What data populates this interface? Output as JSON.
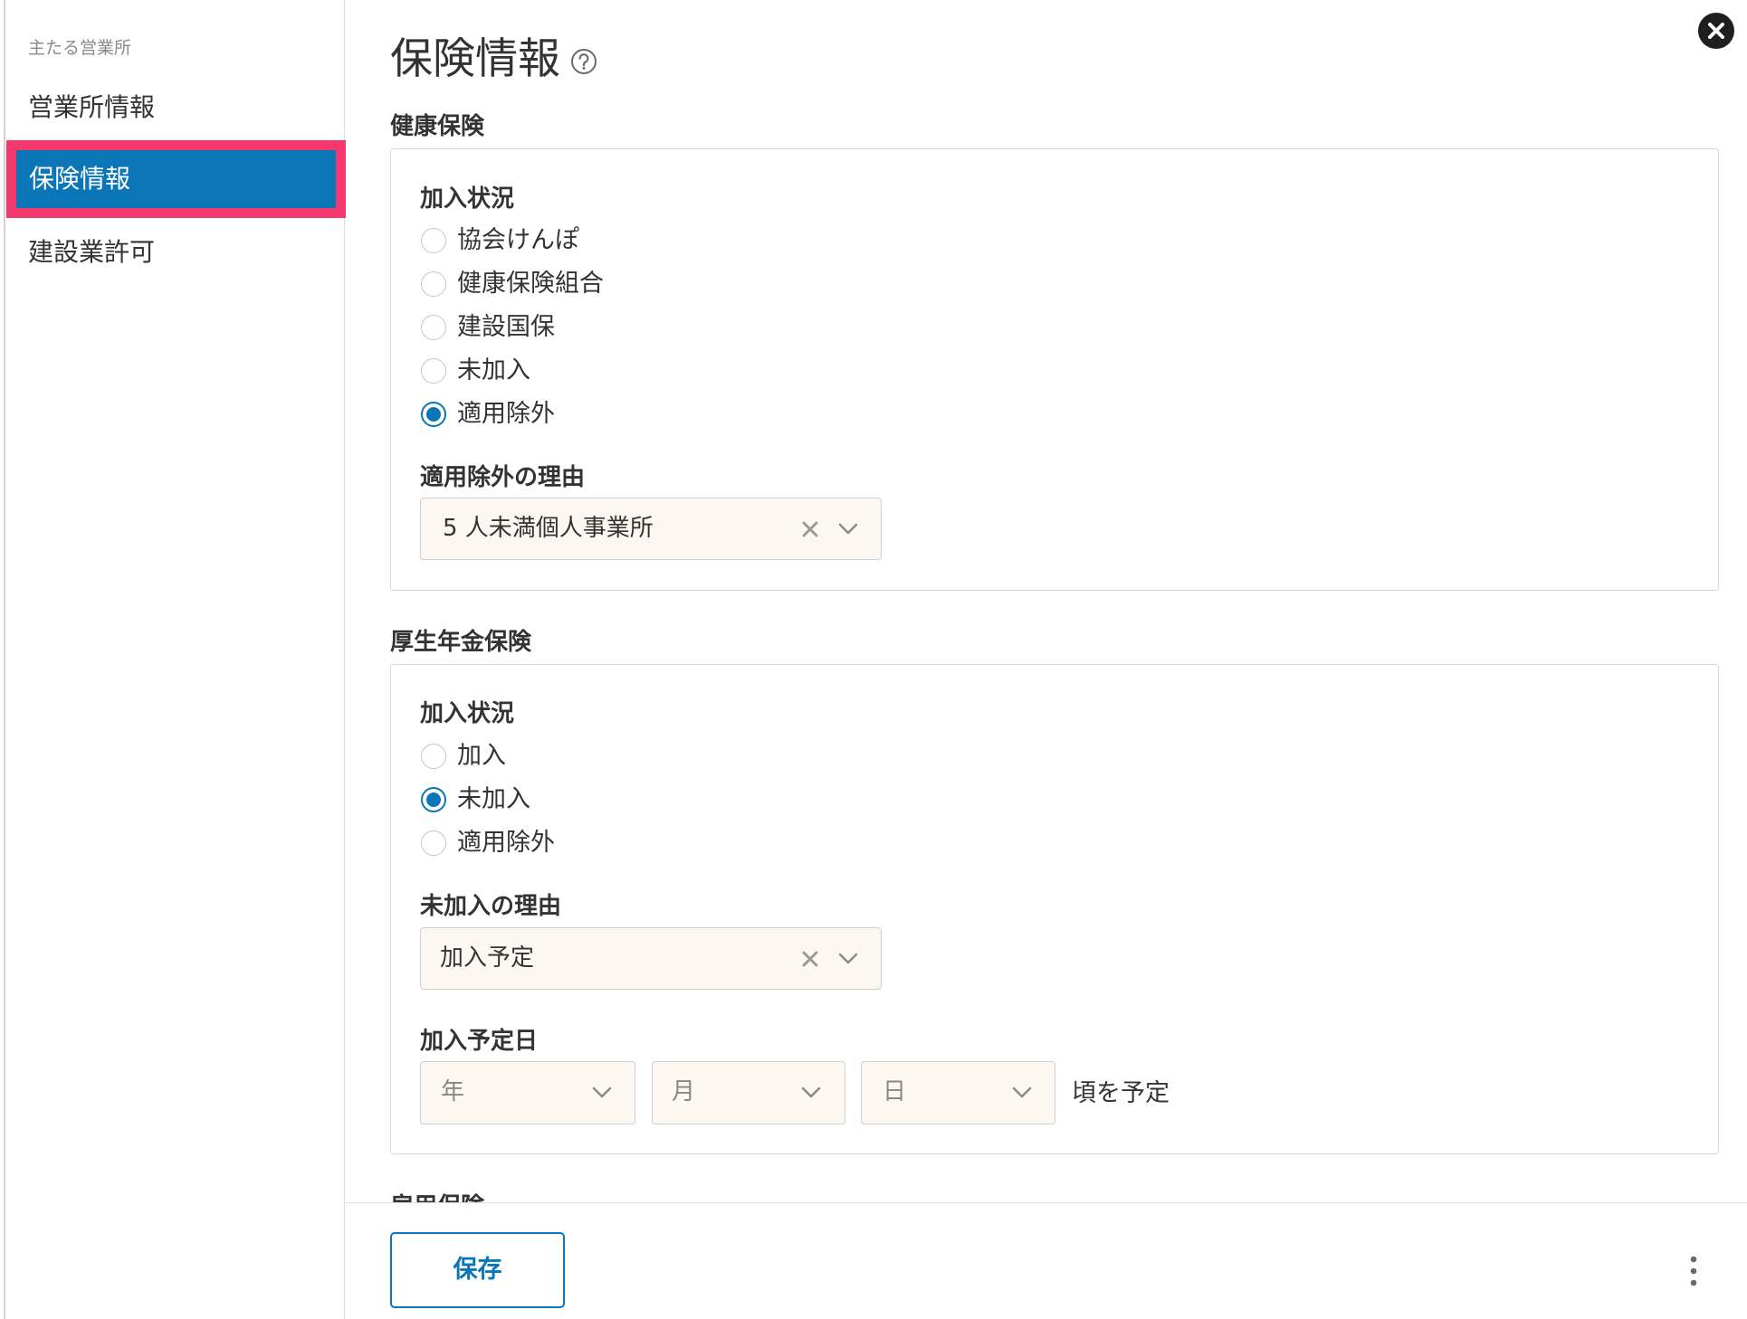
{
  "sidebar": {
    "section_label": "主たる営業所",
    "items": [
      {
        "label": "営業所情報",
        "active": false
      },
      {
        "label": "保険情報",
        "active": true
      },
      {
        "label": "建設業許可",
        "active": false
      }
    ]
  },
  "page": {
    "title": "保険情報",
    "help_icon": "help-circle-icon",
    "close_icon": "close-icon"
  },
  "health_insurance": {
    "heading": "健康保険",
    "status_label": "加入状況",
    "options": [
      {
        "label": "協会けんぽ",
        "checked": false
      },
      {
        "label": "健康保険組合",
        "checked": false
      },
      {
        "label": "建設国保",
        "checked": false
      },
      {
        "label": "未加入",
        "checked": false
      },
      {
        "label": "適用除外",
        "checked": true
      }
    ],
    "reason_label": "適用除外の理由",
    "reason_value": "5 人未満個人事業所"
  },
  "pension_insurance": {
    "heading": "厚生年金保険",
    "status_label": "加入状況",
    "options": [
      {
        "label": "加入",
        "checked": false
      },
      {
        "label": "未加入",
        "checked": true
      },
      {
        "label": "適用除外",
        "checked": false
      }
    ],
    "reason_label": "未加入の理由",
    "reason_value": "加入予定",
    "date_label": "加入予定日",
    "date": {
      "year_placeholder": "年",
      "month_placeholder": "月",
      "day_placeholder": "日"
    },
    "date_suffix": "頃を予定"
  },
  "employment_insurance": {
    "heading": "雇用保険"
  },
  "footer": {
    "save_label": "保存",
    "more_icon": "more-vertical-icon"
  },
  "colors": {
    "accent": "#0a76b8",
    "highlight_border": "#f5386d",
    "select_background": "#fcf8f1"
  }
}
